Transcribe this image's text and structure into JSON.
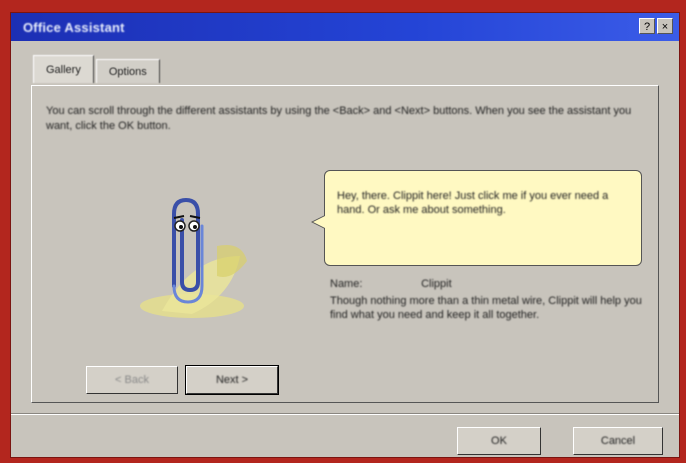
{
  "window": {
    "title": "Office Assistant",
    "buttons": {
      "help": "?",
      "close": "×"
    }
  },
  "tabs": [
    {
      "label": "Gallery"
    },
    {
      "label": "Options"
    }
  ],
  "gallery": {
    "instructions": "You can scroll through the different assistants by using the <Back> and <Next> buttons. When you see the assistant you want, click the OK button.",
    "balloon_text": "Hey, there. Clippit here! Just click me if you ever need a hand. Or ask me about something.",
    "name_label": "Name:",
    "name_value": "Clippit",
    "description": "Though nothing more than a thin metal wire, Clippit will help you find what you need and keep it all together.",
    "back_button": "< Back",
    "next_button": "Next >"
  },
  "footer": {
    "ok_button": "OK",
    "cancel_button": "Cancel"
  },
  "colors": {
    "titlebar": "#2444d6",
    "window": "#c8c4bc",
    "balloon": "#fff9c2",
    "border": "#b3261e"
  },
  "icons": {
    "assistant": "paperclip-assistant-icon"
  }
}
